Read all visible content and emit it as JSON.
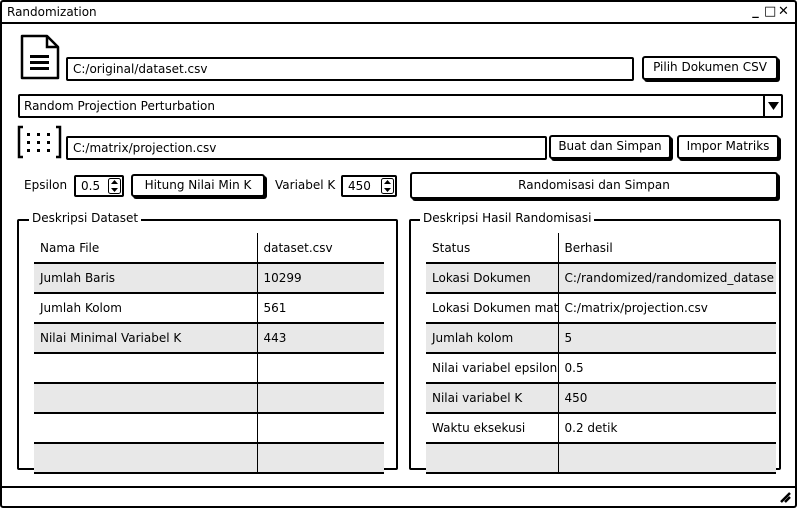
{
  "window": {
    "title": "Randomization",
    "controls": {
      "minimize": "_",
      "maximize": "□",
      "close": "✕"
    }
  },
  "document": {
    "path": "C:/original/dataset.csv",
    "choose_button": "Pilih Dokumen CSV",
    "icon": "document-icon"
  },
  "method": {
    "selected": "Random Projection Perturbation"
  },
  "matrix": {
    "path": "C:/matrix/projection.csv",
    "create_button": "Buat dan Simpan",
    "import_button": "Impor Matriks",
    "icon": "matrix-icon"
  },
  "params": {
    "epsilon_label": "Epsilon",
    "epsilon_value": "0.5",
    "compute_button": "Hitung Nilai Min K",
    "k_label": "Variabel K",
    "k_value": "450",
    "randomize_button": "Randomisasi dan Simpan"
  },
  "dataset_panel": {
    "title": "Deskripsi Dataset",
    "rows": [
      [
        "Nama File",
        "dataset.csv"
      ],
      [
        "Jumlah Baris",
        "10299"
      ],
      [
        "Jumlah Kolom",
        "561"
      ],
      [
        "Nilai Minimal Variabel K",
        "443"
      ],
      [
        "",
        ""
      ],
      [
        "",
        ""
      ],
      [
        "",
        ""
      ],
      [
        "",
        ""
      ]
    ]
  },
  "result_panel": {
    "title": "Deskripsi Hasil Randomisasi",
    "rows": [
      [
        "Status",
        "Berhasil"
      ],
      [
        "Lokasi Dokumen",
        "C:/randomized/randomized_datase"
      ],
      [
        "Lokasi Dokumen mat",
        "C:/matrix/projection.csv"
      ],
      [
        "Jumlah kolom",
        "5"
      ],
      [
        "Nilai variabel epsilon",
        "0.5"
      ],
      [
        "Nilai variabel K",
        "450"
      ],
      [
        "Waktu eksekusi",
        "0.2 detik"
      ],
      [
        "",
        ""
      ]
    ]
  }
}
